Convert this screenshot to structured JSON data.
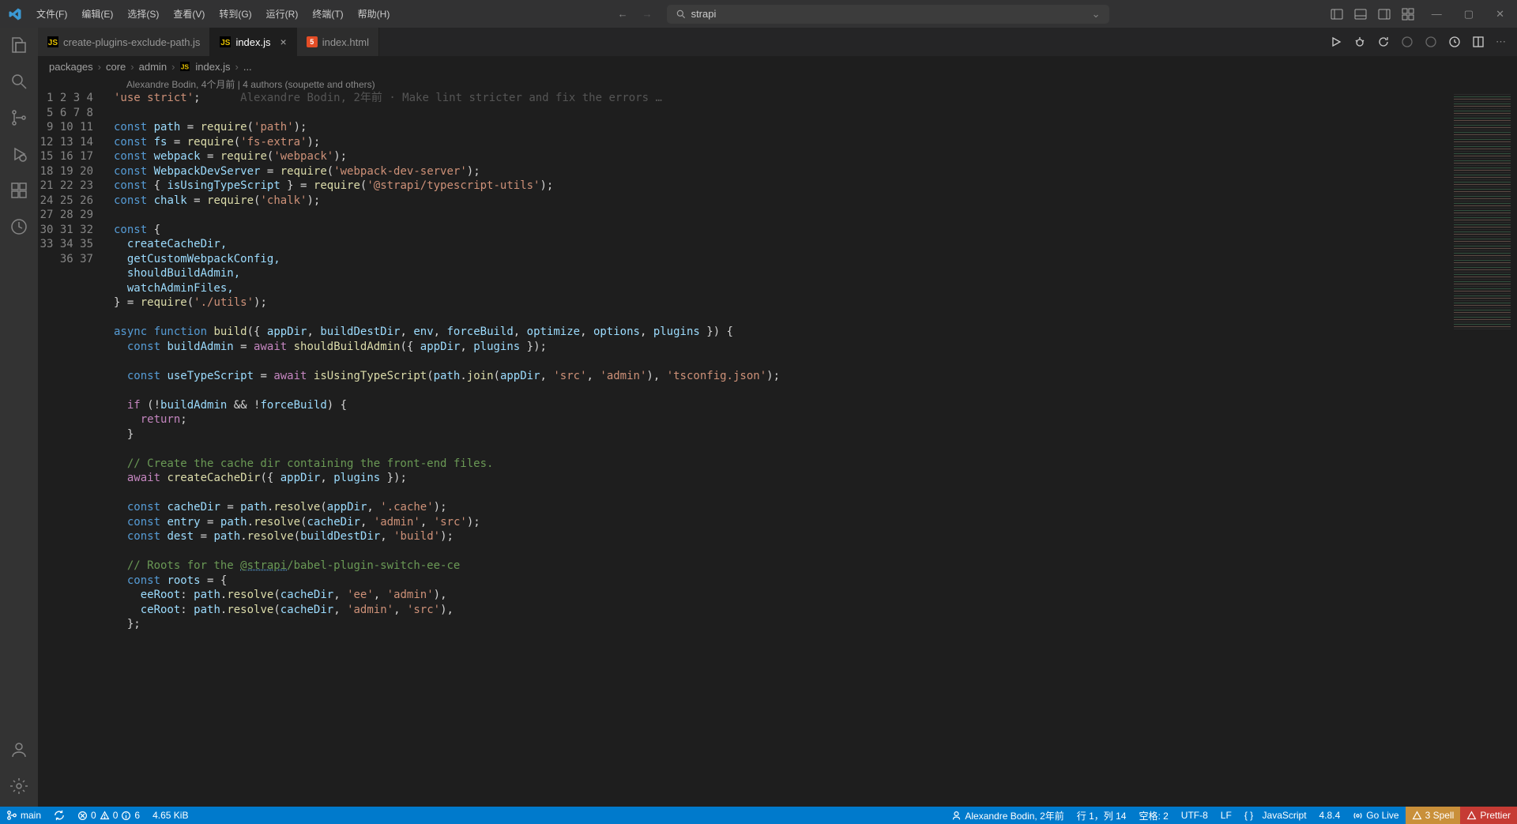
{
  "menu": {
    "file": "文件(F)",
    "edit": "编辑(E)",
    "select": "选择(S)",
    "view": "查看(V)",
    "goto": "转到(G)",
    "run": "运行(R)",
    "terminal": "终端(T)",
    "help": "帮助(H)"
  },
  "search": {
    "text": "strapi"
  },
  "tabs": [
    {
      "label": "create-plugins-exclude-path.js",
      "icon": "JS",
      "active": false
    },
    {
      "label": "index.js",
      "icon": "JS",
      "active": true
    },
    {
      "label": "index.html",
      "icon": "5",
      "active": false
    }
  ],
  "breadcrumb": {
    "seg1": "packages",
    "seg2": "core",
    "seg3": "admin",
    "seg4": "index.js",
    "tail": "..."
  },
  "codelens": "Alexandre Bodin, 4个月前 | 4 authors (soupette and others)",
  "inline_blame": "Alexandre Bodin, 2年前 · Make lint stricter and fix the errors …",
  "line_count": 37,
  "code": {
    "l1_a": "'use strict'",
    "l1_b": ";",
    "l3_a": "const",
    "l3_b": " path ",
    "l3_c": "=",
    "l3_d": " require",
    "l3_e": "(",
    "l3_f": "'path'",
    "l3_g": ");",
    "l4_a": "const",
    "l4_b": " fs ",
    "l4_c": "=",
    "l4_d": " require",
    "l4_e": "(",
    "l4_f": "'fs-extra'",
    "l4_g": ");",
    "l5_a": "const",
    "l5_b": " webpack ",
    "l5_c": "=",
    "l5_d": " require",
    "l5_e": "(",
    "l5_f": "'webpack'",
    "l5_g": ");",
    "l6_a": "const",
    "l6_b": " WebpackDevServer ",
    "l6_c": "=",
    "l6_d": " require",
    "l6_e": "(",
    "l6_f": "'webpack-dev-server'",
    "l6_g": ");",
    "l7_a": "const",
    "l7_b": " { ",
    "l7_c": "isUsingTypeScript",
    "l7_d": " } ",
    "l7_e": "=",
    "l7_f": " require",
    "l7_g": "(",
    "l7_h": "'@strapi/typescript-utils'",
    "l7_i": ");",
    "l8_a": "const",
    "l8_b": " chalk ",
    "l8_c": "=",
    "l8_d": " require",
    "l8_e": "(",
    "l8_f": "'chalk'",
    "l8_g": ");",
    "l10": "const {",
    "l11": "  createCacheDir,",
    "l12": "  getCustomWebpackConfig,",
    "l13": "  shouldBuildAdmin,",
    "l14": "  watchAdminFiles,",
    "l15_a": "} = ",
    "l15_b": "require",
    "l15_c": "(",
    "l15_d": "'./utils'",
    "l15_e": ");",
    "l17_a": "async function",
    "l17_b": " build",
    "l17_c": "({ ",
    "l17_d": "appDir",
    "l17_e": ", ",
    "l17_f": "buildDestDir",
    "l17_g": ", ",
    "l17_h": "env",
    "l17_i": ", ",
    "l17_j": "forceBuild",
    "l17_k": ", ",
    "l17_l": "optimize",
    "l17_m": ", ",
    "l17_n": "options",
    "l17_o": ", ",
    "l17_p": "plugins",
    "l17_q": " }) {",
    "l18_a": "  const",
    "l18_b": " buildAdmin ",
    "l18_c": "=",
    "l18_d": " await",
    "l18_e": " shouldBuildAdmin",
    "l18_f": "({ ",
    "l18_g": "appDir",
    "l18_h": ", ",
    "l18_i": "plugins",
    "l18_j": " });",
    "l20_a": "  const",
    "l20_b": " useTypeScript ",
    "l20_c": "=",
    "l20_d": " await",
    "l20_e": " isUsingTypeScript",
    "l20_f": "(",
    "l20_g": "path",
    "l20_h": ".",
    "l20_i": "join",
    "l20_j": "(",
    "l20_k": "appDir",
    "l20_l": ", ",
    "l20_m": "'src'",
    "l20_n": ", ",
    "l20_o": "'admin'",
    "l20_p": "), ",
    "l20_q": "'tsconfig.json'",
    "l20_r": ");",
    "l22_a": "  if",
    "l22_b": " (!",
    "l22_c": "buildAdmin",
    "l22_d": " && !",
    "l22_e": "forceBuild",
    "l22_f": ") {",
    "l23_a": "    return",
    "l23_b": ";",
    "l24": "  }",
    "l26": "  // Create the cache dir containing the front-end files.",
    "l27_a": "  await",
    "l27_b": " createCacheDir",
    "l27_c": "({ ",
    "l27_d": "appDir",
    "l27_e": ", ",
    "l27_f": "plugins",
    "l27_g": " });",
    "l29_a": "  const",
    "l29_b": " cacheDir ",
    "l29_c": "=",
    "l29_d": " path",
    "l29_e": ".",
    "l29_f": "resolve",
    "l29_g": "(",
    "l29_h": "appDir",
    "l29_i": ", ",
    "l29_j": "'.cache'",
    "l29_k": ");",
    "l30_a": "  const",
    "l30_b": " entry ",
    "l30_c": "=",
    "l30_d": " path",
    "l30_e": ".",
    "l30_f": "resolve",
    "l30_g": "(",
    "l30_h": "cacheDir",
    "l30_i": ", ",
    "l30_j": "'admin'",
    "l30_k": ", ",
    "l30_l": "'src'",
    "l30_m": ");",
    "l31_a": "  const",
    "l31_b": " dest ",
    "l31_c": "=",
    "l31_d": " path",
    "l31_e": ".",
    "l31_f": "resolve",
    "l31_g": "(",
    "l31_h": "buildDestDir",
    "l31_i": ", ",
    "l31_j": "'build'",
    "l31_k": ");",
    "l33_a": "  // Roots for the ",
    "l33_b": "@strapi",
    "l33_c": "/babel-plugin-switch-ee-ce",
    "l34_a": "  const",
    "l34_b": " roots ",
    "l34_c": "=",
    "l34_d": " {",
    "l35_a": "    eeRoot",
    "l35_b": ": ",
    "l35_c": "path",
    "l35_d": ".",
    "l35_e": "resolve",
    "l35_f": "(",
    "l35_g": "cacheDir",
    "l35_h": ", ",
    "l35_i": "'ee'",
    "l35_j": ", ",
    "l35_k": "'admin'",
    "l35_l": "),",
    "l36_a": "    ceRoot",
    "l36_b": ": ",
    "l36_c": "path",
    "l36_d": ".",
    "l36_e": "resolve",
    "l36_f": "(",
    "l36_g": "cacheDir",
    "l36_h": ", ",
    "l36_i": "'admin'",
    "l36_j": ", ",
    "l36_k": "'src'",
    "l36_l": "),",
    "l37": "  };"
  },
  "status": {
    "branch": "main",
    "errors": "0",
    "warnings": "0",
    "info": "6",
    "size": "4.65 KiB",
    "blame": "Alexandre Bodin, 2年前",
    "pos": "行 1，列 14",
    "spaces": "空格: 2",
    "encoding": "UTF-8",
    "eol": "LF",
    "lang": "JavaScript",
    "ver": "4.8.4",
    "golive": "Go Live",
    "spell": "3 Spell",
    "prettier": "Prettier"
  }
}
